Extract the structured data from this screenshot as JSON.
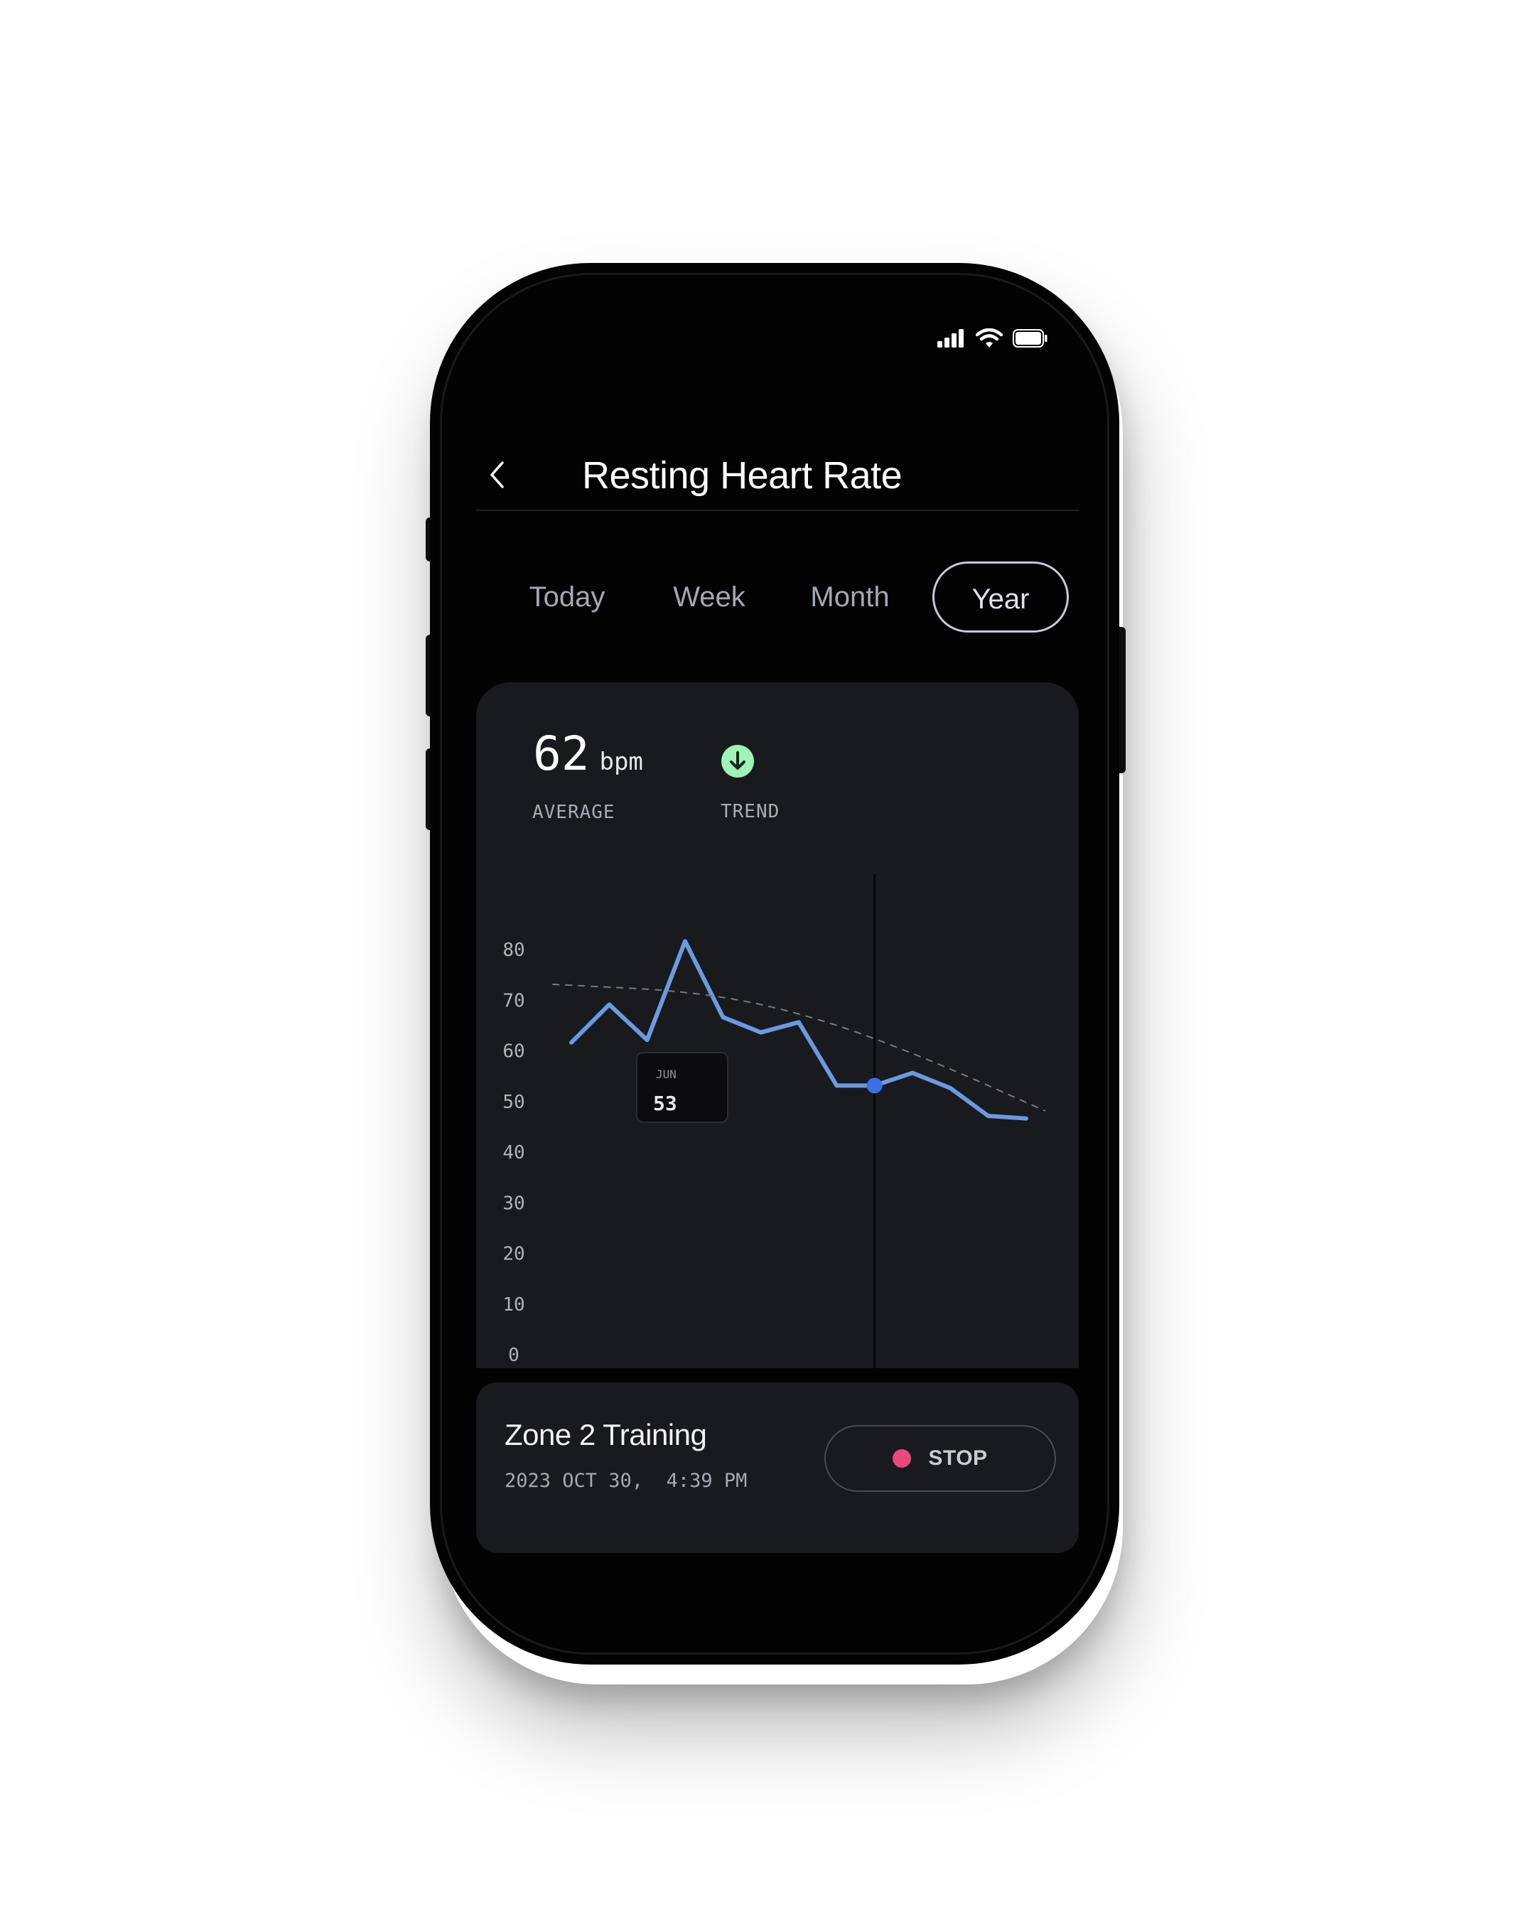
{
  "header": {
    "title": "Resting Heart Rate"
  },
  "tabs": [
    {
      "label": "Today",
      "active": false
    },
    {
      "label": "Week",
      "active": false
    },
    {
      "label": "Month",
      "active": false
    },
    {
      "label": "Year",
      "active": true
    }
  ],
  "summary": {
    "average_value": "62",
    "average_unit": "bpm",
    "average_label": "AVERAGE",
    "trend_label": "TREND",
    "trend_direction": "down"
  },
  "tooltip": {
    "month": "JUN",
    "value": "53"
  },
  "chart_data": {
    "type": "line",
    "y_ticks": [
      80,
      70,
      60,
      50,
      40,
      30,
      20,
      10,
      0
    ],
    "ylim": [
      0,
      80
    ],
    "x_range": [
      0,
      12
    ],
    "grid": false,
    "series": [
      {
        "values": [
          [
            0.0,
            61.5
          ],
          [
            1.0,
            69.0
          ],
          [
            2.0,
            62.0
          ],
          [
            3.0,
            81.5
          ],
          [
            4.0,
            66.5
          ],
          [
            5.0,
            63.5
          ],
          [
            6.0,
            65.5
          ],
          [
            7.0,
            53.0
          ],
          [
            8.0,
            53.0
          ],
          [
            9.0,
            55.5
          ],
          [
            10.0,
            52.5
          ],
          [
            11.0,
            47.0
          ],
          [
            12.0,
            46.5
          ]
        ],
        "style": "solid",
        "color": "#6b9ae0"
      },
      {
        "values": [
          [
            -0.5,
            73
          ],
          [
            3.5,
            71.5
          ],
          [
            6.5,
            66.5
          ],
          [
            9.5,
            58
          ],
          [
            12.5,
            48
          ]
        ],
        "style": "dashed",
        "color": "#777a82"
      }
    ],
    "highlight": {
      "x": 8,
      "y": 53,
      "label": "JUN"
    }
  },
  "session": {
    "title": "Zone 2 Training",
    "time": "2023 OCT 30,  4:39 PM",
    "stop_label": "STOP"
  },
  "colors": {
    "accent_line": "#6b9ae0",
    "highlight_dot": "#3d6fe8",
    "trend_green": "#9ff2b8",
    "stop_pink": "#e84a7f"
  }
}
